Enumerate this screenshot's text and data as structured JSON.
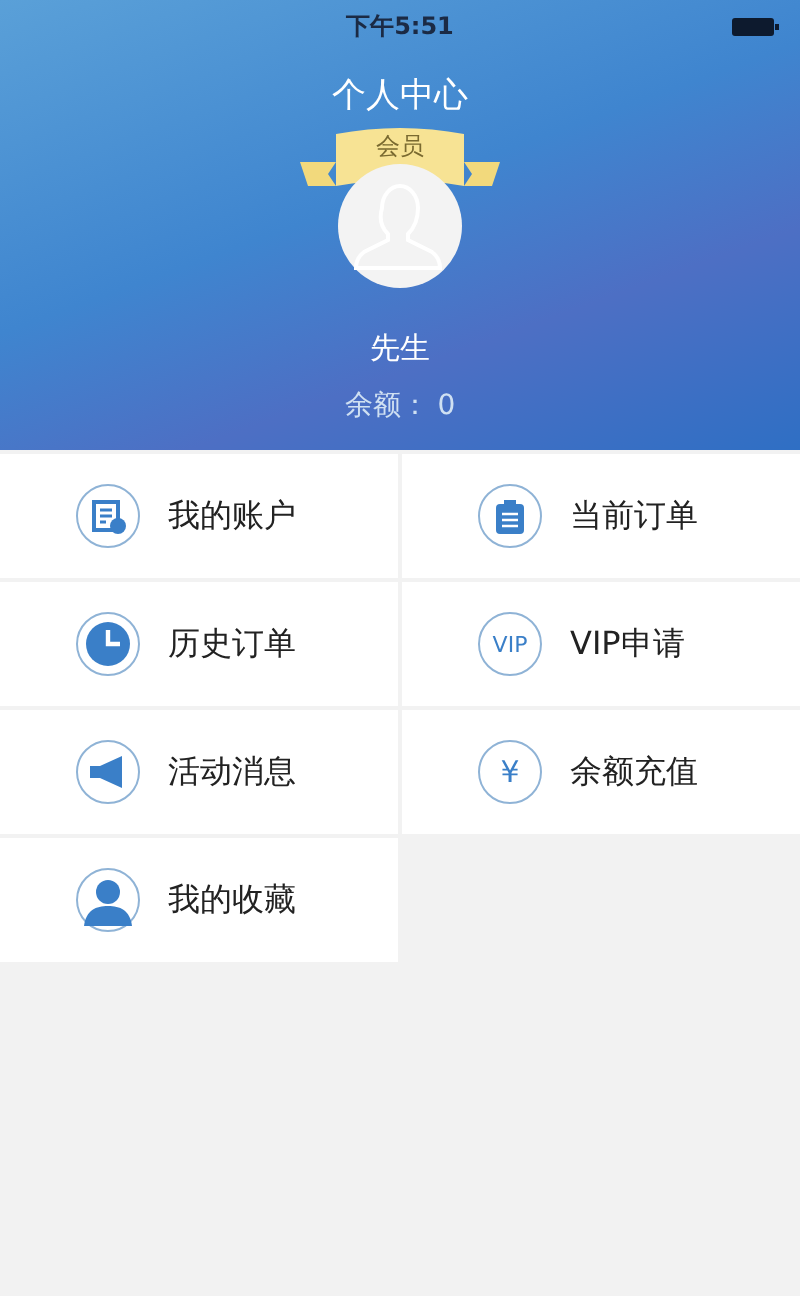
{
  "status_bar": {
    "time": "下午5:51"
  },
  "header": {
    "title": "个人中心",
    "badge": "会员",
    "name": "先生",
    "balance_label": "余额：",
    "balance": "0"
  },
  "menu": [
    {
      "kind": "account",
      "label": "我的账户"
    },
    {
      "kind": "clipboard",
      "label": "当前订单"
    },
    {
      "kind": "clock",
      "label": "历史订单"
    },
    {
      "kind": "text",
      "icon_text": "VIP",
      "label": "VIP申请"
    },
    {
      "kind": "megaphone",
      "label": "活动消息"
    },
    {
      "kind": "text",
      "icon_text": "¥",
      "label": "余额充值"
    },
    {
      "kind": "person",
      "label": "我的收藏"
    }
  ]
}
